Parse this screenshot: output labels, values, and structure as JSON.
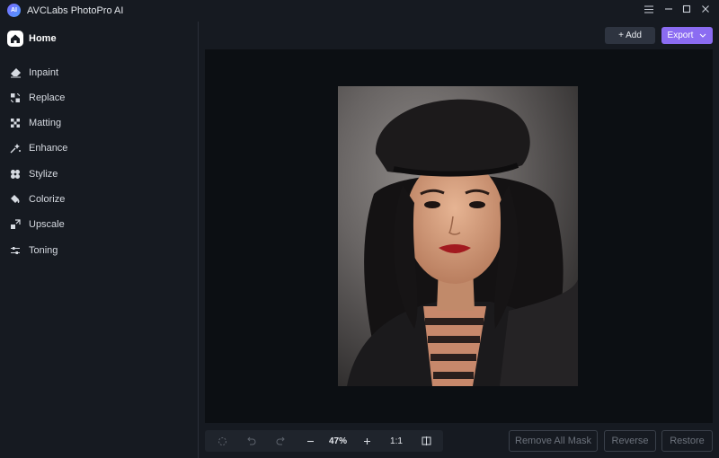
{
  "app": {
    "title": "AVCLabs PhotoPro AI",
    "logo_text": "AI"
  },
  "window_controls": [
    "menu-icon",
    "minimize-icon",
    "maximize-icon",
    "close-icon"
  ],
  "sidebar": {
    "home_label": "Home",
    "items": [
      {
        "label": "Inpaint",
        "icon": "eraser-icon"
      },
      {
        "label": "Replace",
        "icon": "replace-icon"
      },
      {
        "label": "Matting",
        "icon": "matting-icon"
      },
      {
        "label": "Enhance",
        "icon": "enhance-icon"
      },
      {
        "label": "Stylize",
        "icon": "stylize-icon"
      },
      {
        "label": "Colorize",
        "icon": "colorize-icon"
      },
      {
        "label": "Upscale",
        "icon": "upscale-icon"
      },
      {
        "label": "Toning",
        "icon": "toning-icon"
      }
    ]
  },
  "toolbar": {
    "add_label": "+ Add",
    "export_label": "Export"
  },
  "bottom": {
    "zoom": "47%",
    "ratio": "1:1",
    "remove_all_mask": "Remove All Mask",
    "reverse": "Reverse",
    "restore": "Restore"
  },
  "colors": {
    "accent": "#8b6cf2",
    "background": "#161a21",
    "canvas": "#0c0f13"
  }
}
